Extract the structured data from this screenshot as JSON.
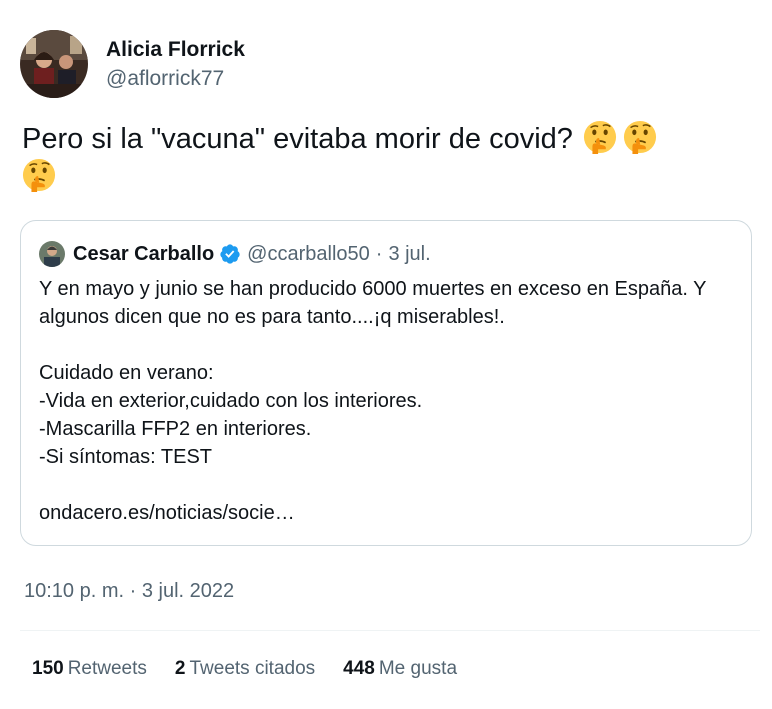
{
  "author": {
    "name": "Alicia Florrick",
    "handle": "@aflorrick77",
    "avatar_icon": "profile-photo"
  },
  "tweet": {
    "text": "Pero si la \"vacuna\" evitaba morir de covid?",
    "emoji_icon": "thinking-face-emoji",
    "emoji_count": 3
  },
  "quoted": {
    "name": "Cesar Carballo",
    "verified_icon": "verified-badge-icon",
    "handle": "@ccarballo50",
    "separator": "·",
    "date": "3 jul.",
    "lines": [
      "Y en mayo y junio se han producido 6000 muertes en exceso en España. Y algunos dicen que no es para tanto....¡q miserables!.",
      "",
      "Cuidado en verano:",
      "-Vida en exterior,cuidado con los interiores.",
      "-Mascarilla FFP2 en interiores.",
      "-Si síntomas: TEST",
      "",
      "ondacero.es/noticias/socie…"
    ]
  },
  "timestamp": "10:10 p. m. · 3 jul. 2022",
  "stats": {
    "retweets": {
      "count": "150",
      "label": "Retweets"
    },
    "quotes": {
      "count": "2",
      "label": "Tweets citados"
    },
    "likes": {
      "count": "448",
      "label": "Me gusta"
    }
  },
  "colors": {
    "text_primary": "#0f1419",
    "text_secondary": "#536471",
    "border": "#cfd9de",
    "verified": "#1d9bf0"
  }
}
